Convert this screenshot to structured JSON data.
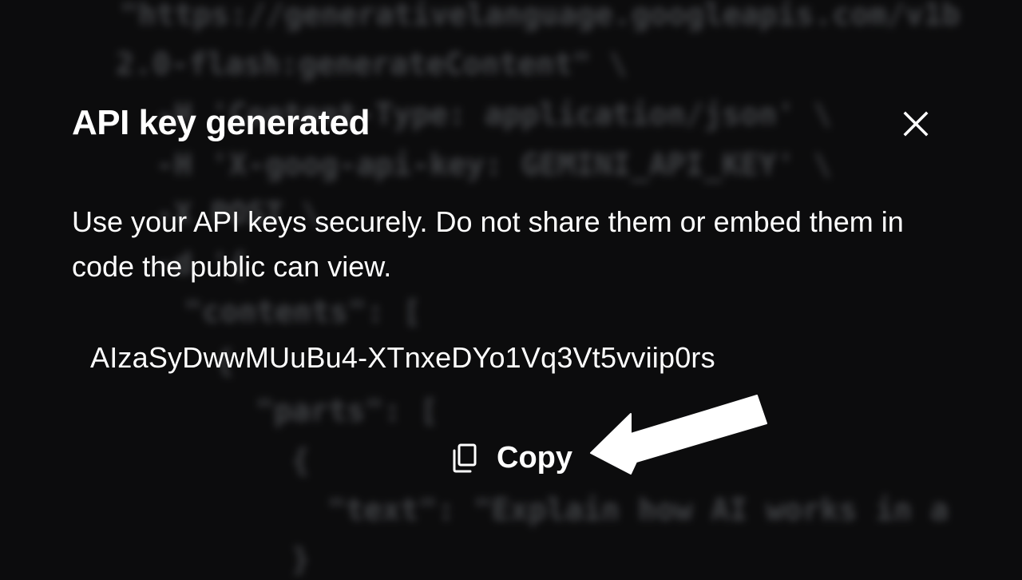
{
  "background_code": {
    "lines": [
      "\"https://generativelanguage.googleapis.com/v1b",
      "2.0-flash:generateContent\" \\",
      "-H 'Content-Type: application/json' \\",
      "-H 'X-goog-api-key: GEMINI_API_KEY' \\",
      "-X POST \\",
      "-d '{",
      "\"contents\": [",
      "{",
      "\"parts\": [",
      "{",
      "\"text\": \"Explain how AI works in a",
      "}"
    ]
  },
  "dialog": {
    "title": "API key generated",
    "close_icon": "close-icon",
    "message": "Use your API keys securely. Do not share them or embed them in code the public can view.",
    "api_key": "AIzaSyDwwMUuBu4-XTnxeDYo1Vq3Vt5vviip0rs",
    "copy_label": "Copy",
    "copy_icon": "copy-icon"
  },
  "annotation": {
    "arrow_icon": "arrow-left-icon",
    "arrow_color": "#ffffff"
  },
  "colors": {
    "background": "#0c0c0d",
    "text": "#ffffff",
    "code_text": "#6f7278"
  }
}
